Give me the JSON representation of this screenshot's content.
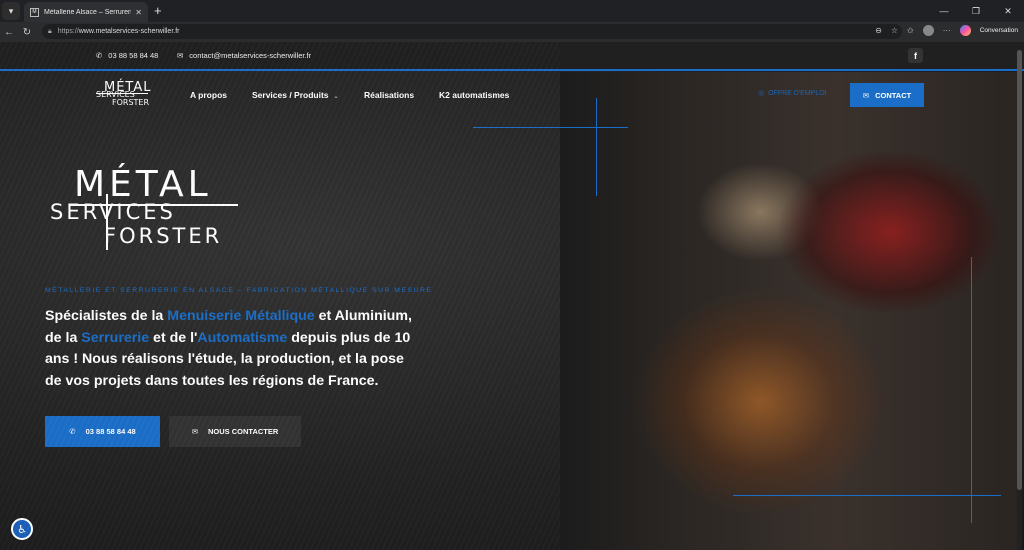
{
  "browser": {
    "tab_title": "Métallerie Alsace – Serrurerie & C",
    "url_prefix": "https://",
    "url_host": "www.metalservices-scherwiller.fr",
    "conversation_label": "Conversation"
  },
  "topbar": {
    "phone": "03 88 58 84 48",
    "email": "contact@metalservices-scherwiller.fr"
  },
  "logo_small": {
    "line1": "MÉTAL",
    "line2": "SERVICES",
    "line3": "FORSTER"
  },
  "nav": {
    "items": [
      "A propos",
      "Services / Produits",
      "Réalisations",
      "K2 automatismes"
    ],
    "offer": "OFFRE D'EMPLOI",
    "contact": "CONTACT"
  },
  "logo_big": {
    "line1": "MÉTAL",
    "line2": "SERVICES",
    "line3": "FORSTER"
  },
  "hero": {
    "tagline": "MÉTALLERIE ET SERRURERIE EN ALSACE – FABRICATION MÉTALLIQUE SUR MESURE",
    "text_a": "Spécialistes de la ",
    "hl_1": "Menuiserie Métallique",
    "text_b": " et Aluminium, de la ",
    "hl_2": "Serrurerie",
    "text_c": " et de l'",
    "hl_3": "Automatisme",
    "text_d": " depuis plus de 10 ans ! Nous réalisons l'étude, la production, et la pose de vos projets dans toutes les régions de France.",
    "btn_phone": "03 88 58 84 48",
    "btn_contact": "NOUS CONTACTER"
  },
  "colors": {
    "accent": "#1b6ec8",
    "bg": "#222222"
  },
  "icons": [
    "tab-menu-icon",
    "favicon-icon",
    "back-icon",
    "reload-icon",
    "lock-icon",
    "phone-icon",
    "mail-icon",
    "facebook-icon",
    "accessibility-icon"
  ]
}
